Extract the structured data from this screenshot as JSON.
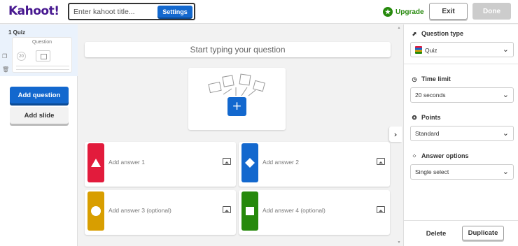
{
  "header": {
    "logo": "Kahoot!",
    "title_placeholder": "Enter kahoot title...",
    "settings_label": "Settings",
    "upgrade_label": "Upgrade",
    "exit_label": "Exit",
    "done_label": "Done"
  },
  "sidebar": {
    "slides": [
      {
        "label": "1  Quiz",
        "thumb_title": "Question",
        "thumb_time": "20"
      }
    ],
    "add_question_label": "Add question",
    "add_slide_label": "Add slide"
  },
  "editor": {
    "question_placeholder": "Start typing your question",
    "media_add_symbol": "+",
    "answers": [
      {
        "placeholder": "Add answer 1",
        "color": "#e21b3c",
        "shape": "triangle"
      },
      {
        "placeholder": "Add answer 2",
        "color": "#1368ce",
        "shape": "diamond"
      },
      {
        "placeholder": "Add answer 3 (optional)",
        "color": "#d89e00",
        "shape": "circle"
      },
      {
        "placeholder": "Add answer 4 (optional)",
        "color": "#26890c",
        "shape": "square"
      }
    ],
    "collapse_symbol": "›"
  },
  "settings_panel": {
    "question_type": {
      "label": "Question type",
      "value": "Quiz"
    },
    "time_limit": {
      "label": "Time limit",
      "value": "20 seconds"
    },
    "points": {
      "label": "Points",
      "value": "Standard"
    },
    "answer_options": {
      "label": "Answer options",
      "value": "Single select"
    },
    "delete_label": "Delete",
    "duplicate_label": "Duplicate"
  },
  "colors": {
    "brand_purple": "#46178f",
    "primary_blue": "#1368ce",
    "upgrade_green": "#26890c"
  }
}
